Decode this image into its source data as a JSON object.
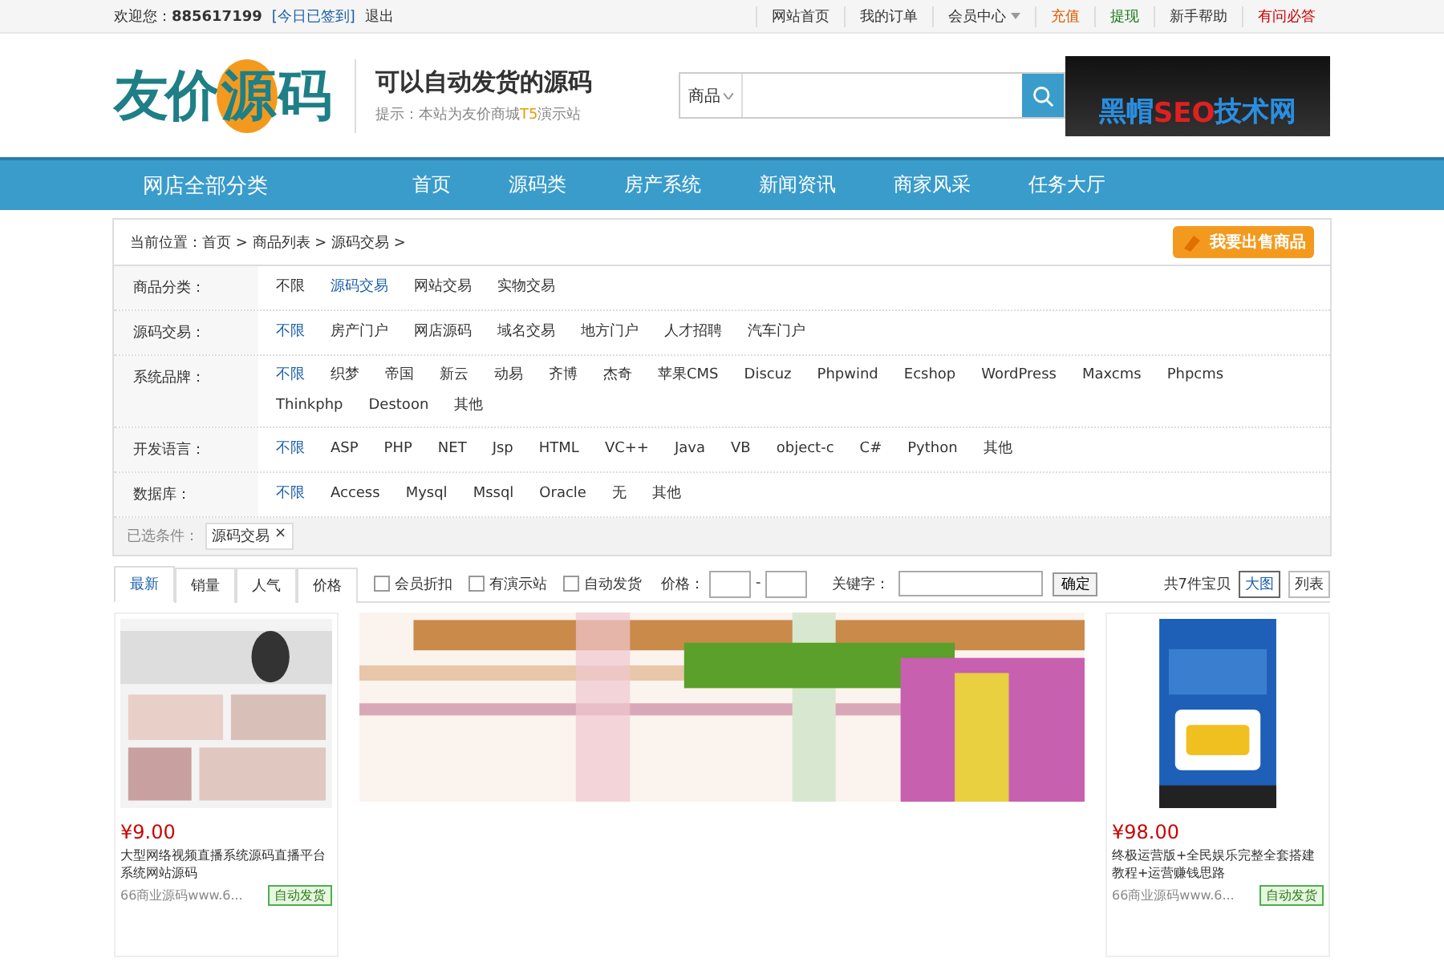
{
  "top_bar": {
    "welcome": "欢迎您：",
    "user": "885617199",
    "checkin": "[今日已签到]",
    "logout": "退出",
    "links": [
      {
        "label": "网站首页",
        "color": "#333333",
        "dropdown": false
      },
      {
        "label": "我的订单",
        "color": "#333333",
        "dropdown": false
      },
      {
        "label": "会员中心",
        "color": "#333333",
        "dropdown": true
      },
      {
        "label": "充值",
        "color": "#e05a00",
        "dropdown": false
      },
      {
        "label": "提现",
        "color": "#1b7a1b",
        "dropdown": false
      },
      {
        "label": "新手帮助",
        "color": "#333333",
        "dropdown": false
      },
      {
        "label": "有问必答",
        "color": "#cc0000",
        "dropdown": false
      }
    ]
  },
  "header": {
    "logo": "友价源码",
    "slogan": "可以自动发货的源码",
    "tip_before": "提示：本站为友价商城",
    "tip_mark": "T5",
    "tip_after": "演示站",
    "search": {
      "scope": "商品"
    },
    "ad": {
      "part1": "黑帽",
      "part2": "SEO",
      "part3": "技术网"
    }
  },
  "nav": {
    "all": "网店全部分类",
    "items": [
      "首页",
      "源码类",
      "房产系统",
      "新闻资讯",
      "商家风采",
      "任务大厅"
    ]
  },
  "breadcrumb": {
    "label": "当前位置：",
    "items": [
      "首页",
      "商品列表",
      "源码交易"
    ],
    "sep": ">",
    "sell": "我要出售商品"
  },
  "filters": [
    {
      "label": "商品分类：",
      "options": [
        {
          "text": "不限",
          "selected": false
        },
        {
          "text": "源码交易",
          "selected": true
        },
        {
          "text": "网站交易",
          "selected": false
        },
        {
          "text": "实物交易",
          "selected": false
        }
      ]
    },
    {
      "label": "源码交易：",
      "options": [
        {
          "text": "不限",
          "selected": true
        },
        {
          "text": "房产门户",
          "selected": false
        },
        {
          "text": "网店源码",
          "selected": false
        },
        {
          "text": "域名交易",
          "selected": false
        },
        {
          "text": "地方门户",
          "selected": false
        },
        {
          "text": "人才招聘",
          "selected": false
        },
        {
          "text": "汽车门户",
          "selected": false
        }
      ]
    },
    {
      "label": "系统品牌：",
      "options": [
        {
          "text": "不限",
          "selected": true
        },
        {
          "text": "织梦",
          "selected": false
        },
        {
          "text": "帝国",
          "selected": false
        },
        {
          "text": "新云",
          "selected": false
        },
        {
          "text": "动易",
          "selected": false
        },
        {
          "text": "齐博",
          "selected": false
        },
        {
          "text": "杰奇",
          "selected": false
        },
        {
          "text": "苹果CMS",
          "selected": false
        },
        {
          "text": "Discuz",
          "selected": false
        },
        {
          "text": "Phpwind",
          "selected": false
        },
        {
          "text": "Ecshop",
          "selected": false
        },
        {
          "text": "WordPress",
          "selected": false
        },
        {
          "text": "Maxcms",
          "selected": false
        },
        {
          "text": "Phpcms",
          "selected": false
        },
        {
          "text": "Thinkphp",
          "selected": false
        },
        {
          "text": "Destoon",
          "selected": false
        },
        {
          "text": "其他",
          "selected": false
        }
      ]
    },
    {
      "label": "开发语言：",
      "options": [
        {
          "text": "不限",
          "selected": true
        },
        {
          "text": "ASP",
          "selected": false
        },
        {
          "text": "PHP",
          "selected": false
        },
        {
          "text": "NET",
          "selected": false
        },
        {
          "text": "Jsp",
          "selected": false
        },
        {
          "text": "HTML",
          "selected": false
        },
        {
          "text": "VC++",
          "selected": false
        },
        {
          "text": "Java",
          "selected": false
        },
        {
          "text": "VB",
          "selected": false
        },
        {
          "text": "object-c",
          "selected": false
        },
        {
          "text": "C#",
          "selected": false
        },
        {
          "text": "Python",
          "selected": false
        },
        {
          "text": "其他",
          "selected": false
        }
      ]
    },
    {
      "label": "数据库：",
      "options": [
        {
          "text": "不限",
          "selected": true
        },
        {
          "text": "Access",
          "selected": false
        },
        {
          "text": "Mysql",
          "selected": false
        },
        {
          "text": "Mssql",
          "selected": false
        },
        {
          "text": "Oracle",
          "selected": false
        },
        {
          "text": "无",
          "selected": false
        },
        {
          "text": "其他",
          "selected": false
        }
      ]
    }
  ],
  "chosen": {
    "label": "已选条件：",
    "tags": [
      "源码交易"
    ],
    "remove": "×"
  },
  "sort_bar": {
    "tabs": [
      {
        "label": "最新",
        "selected": true
      },
      {
        "label": "销量",
        "selected": false
      },
      {
        "label": "人气",
        "selected": false
      },
      {
        "label": "价格",
        "selected": false
      }
    ],
    "checks": [
      {
        "label": "会员折扣",
        "checked": false
      },
      {
        "label": "有演示站",
        "checked": false
      },
      {
        "label": "自动发货",
        "checked": false
      }
    ],
    "price_label": "价格：",
    "dash": "-",
    "keyword_label": "关键字：",
    "confirm": "确定",
    "count": "共7件宝贝",
    "views": [
      {
        "label": "大图",
        "selected": true
      },
      {
        "label": "列表",
        "selected": false
      }
    ]
  },
  "products": [
    {
      "kind": "item",
      "price": "¥9.00",
      "title": "大型网络视频直播系统源码直播平台系统网站源码",
      "shop": "66商业源码www.6...",
      "auto": "自动发货"
    },
    {
      "kind": "blur"
    },
    {
      "kind": "item",
      "price": "¥98.00",
      "title": "终极运营版+全民娱乐完整全套搭建教程+运营赚钱思路",
      "shop": "66商业源码www.6...",
      "auto": "自动发货"
    }
  ]
}
